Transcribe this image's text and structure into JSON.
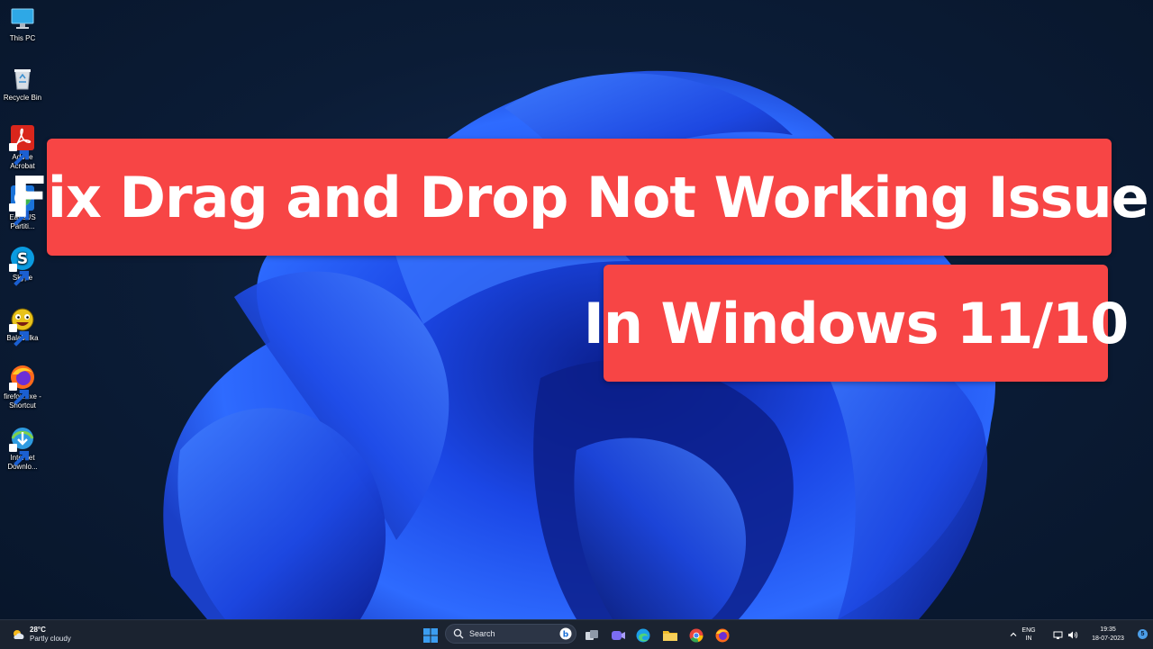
{
  "desktop": {
    "icons": [
      {
        "label": "This PC",
        "icon": "computer-monitor-icon"
      },
      {
        "label": "Recycle Bin",
        "icon": "recycle-bin-icon"
      },
      {
        "label": "Adobe Acrobat",
        "icon": "adobe-acrobat-icon"
      },
      {
        "label": "EaseUS Partiti...",
        "icon": "easeus-partition-icon"
      },
      {
        "label": "Skype",
        "icon": "skype-icon"
      },
      {
        "label": "Balabolka",
        "icon": "balabolka-icon"
      },
      {
        "label": "firefox.exe - Shortcut",
        "icon": "firefox-icon"
      },
      {
        "label": "Internet Downlo...",
        "icon": "internet-download-manager-icon"
      }
    ]
  },
  "title": {
    "line1": "Fix Drag and Drop Not Working Issue",
    "line2": "In Windows 11/10"
  },
  "taskbar": {
    "weather": {
      "temperature": "28°C",
      "condition": "Partly cloudy"
    },
    "search": {
      "placeholder": "Search"
    },
    "tray": {
      "language_line1": "ENG",
      "language_line2": "IN",
      "time": "19:35",
      "date": "18-07-2023",
      "notification_count": "5"
    }
  },
  "colors": {
    "banner": "#f74545",
    "taskbar": "#1b2330",
    "wallpaper_bloom": "#1a4ef0"
  }
}
